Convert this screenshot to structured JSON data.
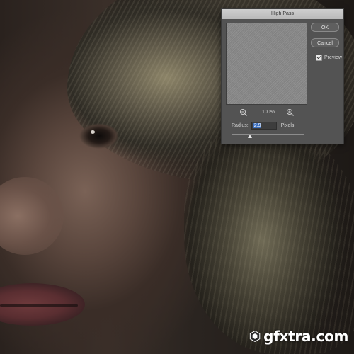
{
  "dialog": {
    "title": "High Pass",
    "ok_label": "OK",
    "cancel_label": "Cancel",
    "preview_label": "Preview",
    "preview_checked": true,
    "zoom_level": "100%",
    "radius_label": "Radius:",
    "radius_value": "2.9",
    "units_label": "Pixels",
    "radius_slider_fraction": 0.25
  },
  "watermark": {
    "text": "gfxtra.com"
  },
  "icons": {
    "zoom_out": "zoom-out-icon",
    "zoom_in": "zoom-in-icon",
    "checkmark": "checkmark-icon",
    "logo": "gfxtra-logo-icon"
  },
  "colors": {
    "dialog_bg": "#535353",
    "title_bar": "#c4c4c4",
    "selection": "#3b6fbf"
  }
}
